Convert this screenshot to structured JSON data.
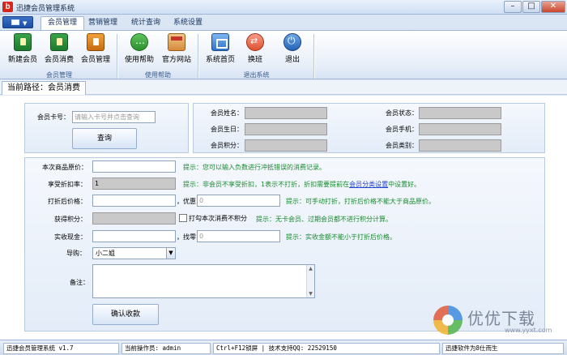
{
  "window": {
    "title": "迅捷会员管理系统"
  },
  "tabs": [
    "会员管理",
    "营销管理",
    "统计查询",
    "系统设置"
  ],
  "ribbon": {
    "buttons": [
      {
        "label": "新建会员",
        "icon": "new-member-icon"
      },
      {
        "label": "会员消费",
        "icon": "member-consume-icon"
      },
      {
        "label": "会员管理",
        "icon": "member-manage-icon"
      },
      {
        "label": "使用帮助",
        "icon": "help-icon"
      },
      {
        "label": "官方网站",
        "icon": "website-icon"
      },
      {
        "label": "系统首页",
        "icon": "home-icon"
      },
      {
        "label": "换班",
        "icon": "shift-icon"
      },
      {
        "label": "退出",
        "icon": "power-icon"
      }
    ],
    "groups": [
      "会员管理",
      "使用帮助",
      "退出系统"
    ]
  },
  "path": {
    "text": "当前路径：会员消费"
  },
  "search": {
    "card_label": "会员卡号：",
    "card_placeholder": "请输入卡号并点击查询",
    "query_button": "查询"
  },
  "member_info": {
    "name_label": "会员姓名：",
    "status_label": "会员状态：",
    "birthday_label": "会员生日：",
    "phone_label": "会员手机：",
    "points_label": "会员积分：",
    "category_label": "会员类别："
  },
  "form": {
    "original_price_label": "本次商品原价：",
    "original_price_hint": "提示：您可以输入负数进行冲抵错误的消费记录。",
    "discount_label": "享受折扣率：",
    "discount_value": "1",
    "discount_hint_pre": "提示：非会员不享受折扣，1表示不打折，折扣需要提前在",
    "discount_hint_link": "会员分类设置",
    "discount_hint_post": "中设置好。",
    "discounted_price_label": "打折后价格：",
    "offer_label": "，优惠",
    "offer_value": "0",
    "discounted_hint": "提示：可手动打折，打折后价格不能大于商品原价。",
    "points_label": "获得积分：",
    "no_points_checkbox": "打勾本次消费不积分",
    "points_hint": "提示：无卡会员、过期会员都不进行积分计算。",
    "cash_label": "实收现金：",
    "change_label": "，找零",
    "change_value": "0",
    "cash_hint": "提示：实收金额不能小于打折后价格。",
    "guide_label": "导购：",
    "guide_value": "小二姐",
    "remark_label": "备注：",
    "confirm_button": "确认收款"
  },
  "statusbar": {
    "app_version": "迅捷会员管理系统 v1.7",
    "operator": "当前操作员: admin",
    "shortcut_support": "Ctrl+F12锁屏 | 技术支持QQ: 22529150",
    "footer": "迅捷软件为8仕而生"
  },
  "watermark": {
    "text": "优优下载",
    "url": "www.yyxt.com"
  },
  "colors": {
    "hint_green": "#168a2c",
    "link_blue": "#2244cc",
    "titlebar": "#cfdff3"
  }
}
